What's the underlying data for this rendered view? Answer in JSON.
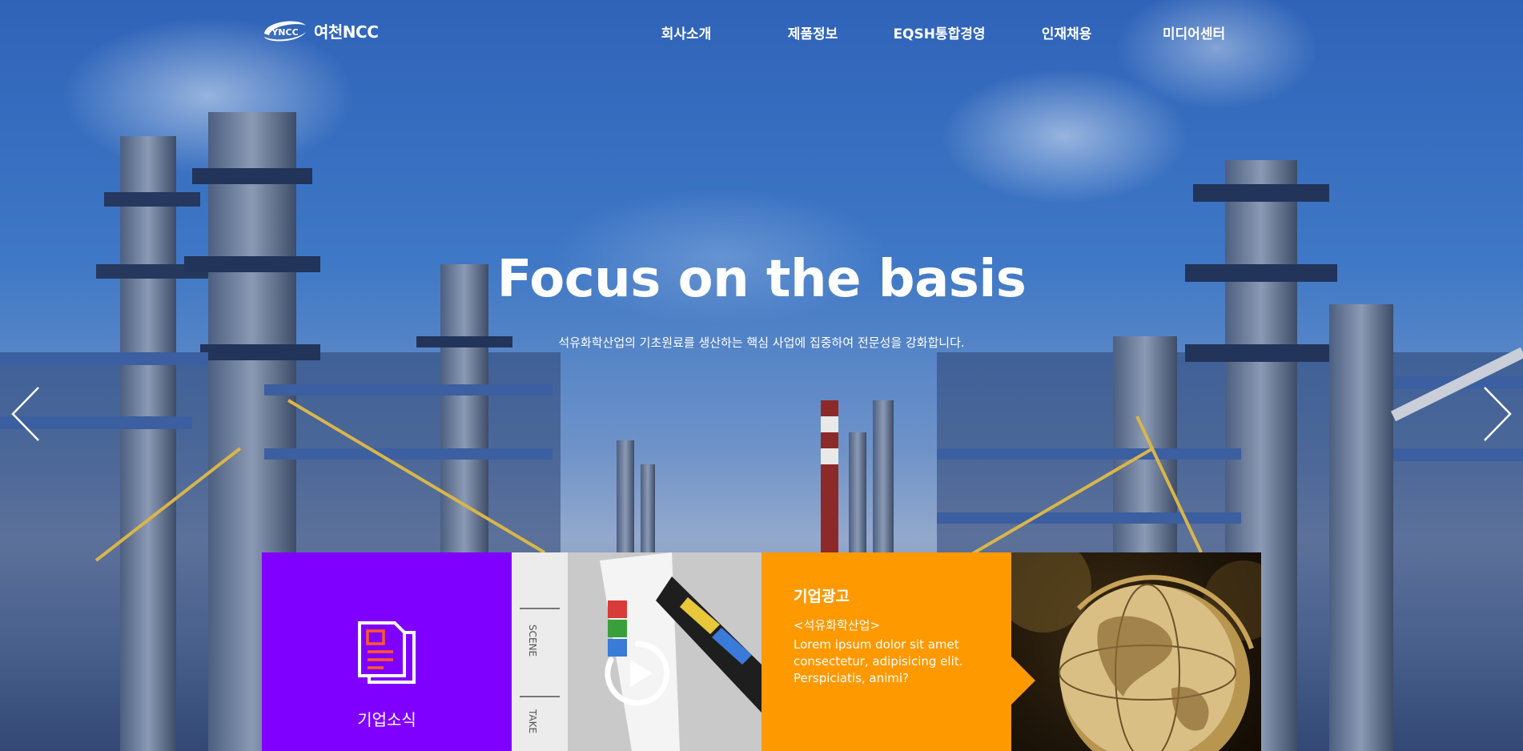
{
  "header": {
    "logo_mark": "YNCC",
    "logo_text": "여천NCC",
    "nav": [
      "회사소개",
      "제품정보",
      "EQSH통합경영",
      "인재채용",
      "미디어센터"
    ]
  },
  "hero": {
    "title": "Focus on the basis",
    "subtitle": "석유화학산업의 기초원료를 생산하는 핵심 사업에 집중하여 전문성을 강화합니다."
  },
  "tiles": {
    "news": {
      "label": "기업소식",
      "icon": "document-icon",
      "color": "#8000ff"
    },
    "video": {
      "icon": "play-icon",
      "clapper_text_1": "SCENE",
      "clapper_text_2": "TAKE"
    },
    "ad": {
      "title": "기업광고",
      "subtitle": "<석유화학산업>",
      "body": "Lorem ipsum dolor sit amet consectetur, adipisicing elit. Perspiciatis, animi?",
      "color": "#ff9900"
    },
    "globe": {
      "icon": "globe-image"
    }
  },
  "controls": {
    "prev_icon": "chevron-left-icon",
    "next_icon": "chevron-right-icon"
  }
}
